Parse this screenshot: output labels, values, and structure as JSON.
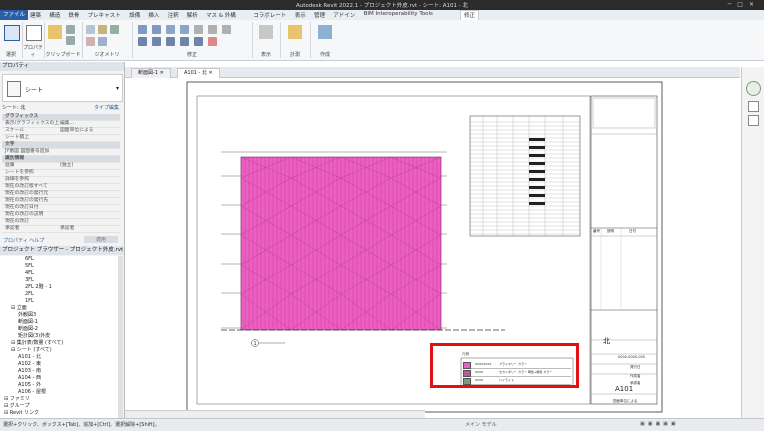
{
  "titlebar": {
    "title": "Autodesk Revit 2022.1 - プロジェクト外皮.rvt - シート: A101 - 北"
  },
  "ribbon": {
    "tabs": [
      "ファイル",
      "建築",
      "構造",
      "鉄骨",
      "プレキャスト",
      "設備",
      "挿入",
      "注釈",
      "解析",
      "マス & 外構",
      "コラボレート",
      "表示",
      "管理",
      "アドイン",
      "BIM Interoperability Tools",
      "修正"
    ],
    "active_tab": "修正",
    "groups": [
      "選択",
      "プロパティ",
      "クリップボード",
      "ジオメトリ",
      "修正",
      "表示",
      "計測",
      "作成"
    ],
    "select_label": "修正"
  },
  "properties": {
    "header": "プロパティ",
    "type_name": "シート",
    "selector": "シート: 北",
    "edit_type": "タイプ編集",
    "rows": [
      {
        "k": "グラフィックス",
        "v": "",
        "sec": true
      },
      {
        "k": "表示/グラフィックスの上...",
        "v": "編集..."
      },
      {
        "k": "スケール",
        "v": "図面単位による"
      },
      {
        "k": "シート積上",
        "v": ""
      },
      {
        "k": "文字",
        "v": "",
        "sec": true
      },
      {
        "k": "JY番図 図面番号追加",
        "v": ""
      },
      {
        "k": "識別情報",
        "v": "",
        "sec": true
      },
      {
        "k": "従属",
        "v": "(独立)"
      },
      {
        "k": "シートを参照",
        "v": ""
      },
      {
        "k": "詳細を参照",
        "v": ""
      },
      {
        "k": "現在の改訂版すべて",
        "v": ""
      },
      {
        "k": "現在の改訂の発行元",
        "v": ""
      },
      {
        "k": "現在の改訂の発行先",
        "v": ""
      },
      {
        "k": "現在の改訂日付",
        "v": ""
      },
      {
        "k": "現在の改訂の説明",
        "v": ""
      },
      {
        "k": "現在の改訂",
        "v": ""
      },
      {
        "k": "承認者",
        "v": "承認者"
      }
    ],
    "help_link": "プロパティ ヘルプ",
    "apply": "適用"
  },
  "browser": {
    "header": "プロジェクト ブラウザー - プロジェクト外皮.rvt",
    "items": [
      {
        "t": "6FL",
        "d": 3
      },
      {
        "t": "5FL",
        "d": 3
      },
      {
        "t": "4FL",
        "d": 3
      },
      {
        "t": "3FL",
        "d": 3
      },
      {
        "t": "2FL 2階 - 1",
        "d": 3
      },
      {
        "t": "2FL",
        "d": 3
      },
      {
        "t": "1FL",
        "d": 3
      },
      {
        "t": "立面",
        "d": 1
      },
      {
        "t": "外観図3",
        "d": 2
      },
      {
        "t": "断面図-1",
        "d": 2
      },
      {
        "t": "断面図-2",
        "d": 2
      },
      {
        "t": "矩計図(3)外皮",
        "d": 2
      },
      {
        "t": "集計表/数量 (すべて)",
        "d": 1
      },
      {
        "t": "シート (すべて)",
        "d": 1
      },
      {
        "t": "A101 - 北",
        "d": 2
      },
      {
        "t": "A102 - 東",
        "d": 2
      },
      {
        "t": "A103 - 南",
        "d": 2
      },
      {
        "t": "A104 - 西",
        "d": 2
      },
      {
        "t": "A105 - 外",
        "d": 2
      },
      {
        "t": "A106 - 屋根",
        "d": 2
      },
      {
        "t": "ファミリ",
        "d": 0
      },
      {
        "t": "グループ",
        "d": 0
      },
      {
        "t": "Revit リンク",
        "d": 0
      }
    ]
  },
  "view_tabs": [
    {
      "label": "断面図-1",
      "active": false
    },
    {
      "label": "A101 - 北",
      "active": true
    }
  ],
  "sheet": {
    "title": "北",
    "number": "A101",
    "scale": "図面単位による",
    "project_number": "0000-0000-000",
    "date": "発行日",
    "author": "作成者",
    "checker": "承認者",
    "rev_headers": [
      "番号",
      "説明",
      "日付"
    ],
    "legend_title": "凡例",
    "legend_rows": [
      {
        "code": "XXXXXXXX",
        "desc": "プライマリー カラー"
      },
      {
        "code": "XXXX",
        "desc": "セカンダリー カラー 明色+暗色 カラー"
      },
      {
        "code": "XXXX",
        "desc": "ハイライト"
      }
    ],
    "grid_marker": "1"
  },
  "statusbar": {
    "message": "選択+クリック、ボックス+[Tab]、追加+[Ctrl]、選択解除+[Shift]。",
    "model": "メイン モデル"
  },
  "colors": {
    "facade": "#ee5ec1",
    "accent": "#2a5ea8",
    "highlight": "#e21010"
  }
}
